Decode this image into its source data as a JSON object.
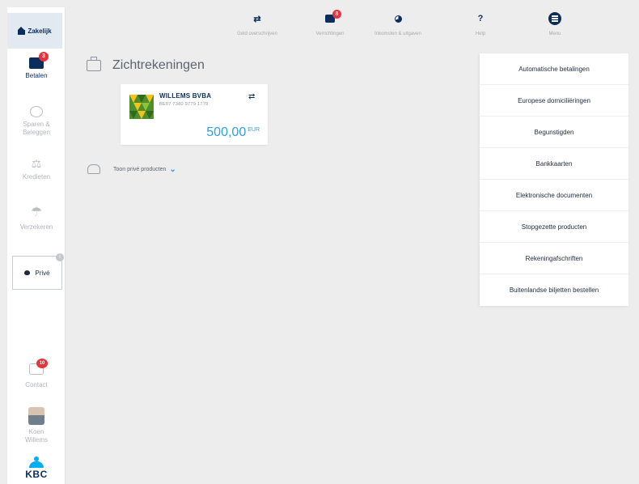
{
  "sidebar": {
    "top_tab": "Zakelijk",
    "items": [
      {
        "label": "Betalen",
        "badge": "3",
        "icon": "wallet-icon",
        "active": true
      },
      {
        "label": "Sparen & Beleggen",
        "icon": "piggy-bank-icon",
        "active": false
      },
      {
        "label": "Kredieten",
        "icon": "coins-icon",
        "active": false
      },
      {
        "label": "Verzekeren",
        "icon": "umbrella-icon",
        "active": false
      }
    ],
    "prive_label": "Privé",
    "contact": {
      "label": "Contact",
      "badge": "10"
    },
    "user": {
      "name": "Koen Willems"
    },
    "logo_text": "KBC"
  },
  "topbar": {
    "items": [
      {
        "label": "Geld overschrijven",
        "icon": "transfer-icon"
      },
      {
        "label": "Verrichtingen",
        "icon": "inbox-icon",
        "badge": "8"
      },
      {
        "label": "Inkomsten & uitgaven",
        "icon": "pie-chart-icon"
      },
      {
        "label": "Help",
        "icon": "help-icon",
        "glyph": "?"
      },
      {
        "label": "Menu",
        "icon": "menu-icon"
      }
    ]
  },
  "main": {
    "section_title": "Zichtrekeningen",
    "account": {
      "name": "WILLEMS BVBA",
      "iban": "BE07 7380 9779 1779",
      "amount": "500,00",
      "currency": "EUR"
    },
    "private_toggle": "Toon privé producten"
  },
  "menu_panel": {
    "items": [
      "Automatische betalingen",
      "Europese domiciliëringen",
      "Begunstigden",
      "Bankkaarten",
      "Elektronische documenten",
      "Stopgezette producten",
      "Rekeningafschriften",
      "Buitenlandse biljetten bestellen"
    ]
  },
  "colors": {
    "navy": "#0b2d5b",
    "accent_blue": "#2f9fe3",
    "badge_red": "#e8323c",
    "kbc_blue": "#00aeef"
  }
}
